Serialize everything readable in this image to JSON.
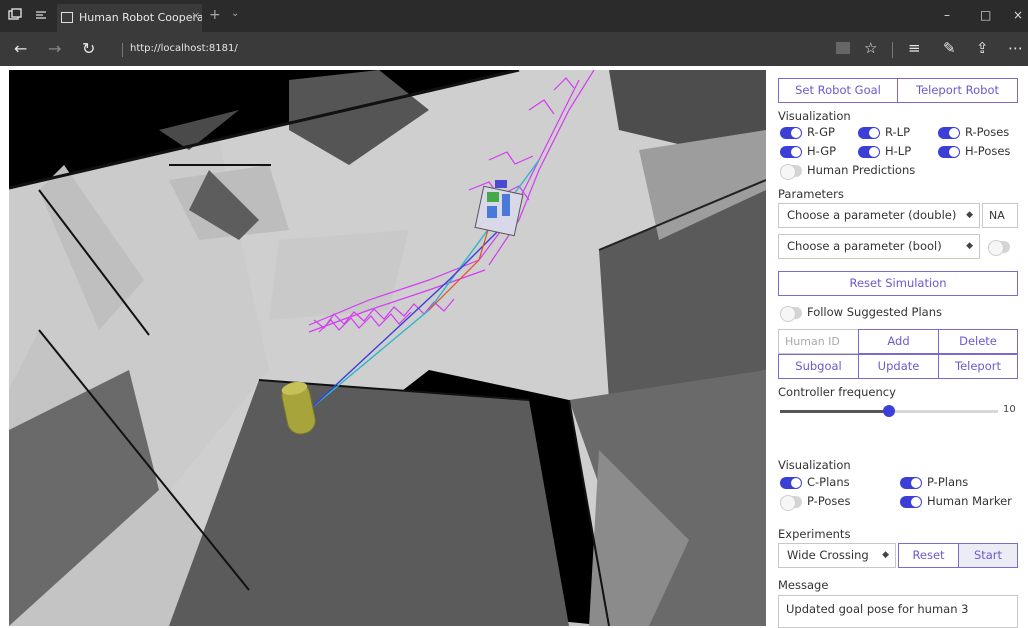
{
  "browser": {
    "tab_title": "Human Robot Cooperat",
    "tab_close": "×",
    "new_tab": "+",
    "tab_list": "⌄",
    "address": "http://localhost:8181/",
    "minimize": "–",
    "maximize": "□",
    "close": "×"
  },
  "panel": {
    "set_robot_goal": "Set Robot Goal",
    "teleport_robot": "Teleport Robot",
    "visualization_1": {
      "label": "Visualization",
      "toggles": [
        {
          "label": "R-GP",
          "on": true
        },
        {
          "label": "R-LP",
          "on": true
        },
        {
          "label": "R-Poses",
          "on": true
        },
        {
          "label": "H-GP",
          "on": true
        },
        {
          "label": "H-LP",
          "on": true
        },
        {
          "label": "H-Poses",
          "on": true
        },
        {
          "label": "Human Predictions",
          "on": false
        }
      ]
    },
    "parameters": {
      "label": "Parameters",
      "double_select": "Choose a parameter (double)",
      "double_value": "NA",
      "bool_select": "Choose a parameter (bool)",
      "bool_on": false
    },
    "reset_simulation": "Reset Simulation",
    "follow_suggested_plans": {
      "label": "Follow Suggested Plans",
      "on": false
    },
    "human_id_placeholder": "Human ID",
    "add": "Add",
    "delete": "Delete",
    "subgoal": "Subgoal",
    "update": "Update",
    "teleport": "Teleport",
    "controller_frequency": {
      "label": "Controller frequency",
      "value": "10",
      "level": 0.5
    },
    "visualization_2": {
      "label": "Visualization",
      "toggles": [
        {
          "label": "C-Plans",
          "on": true
        },
        {
          "label": "P-Plans",
          "on": true
        },
        {
          "label": "P-Poses",
          "on": false
        },
        {
          "label": "Human Marker",
          "on": true
        }
      ]
    },
    "experiments": {
      "label": "Experiments",
      "select": "Wide Crossing",
      "reset": "Reset",
      "start": "Start"
    },
    "message": {
      "label": "Message",
      "text": "Updated goal pose for human 3"
    }
  }
}
